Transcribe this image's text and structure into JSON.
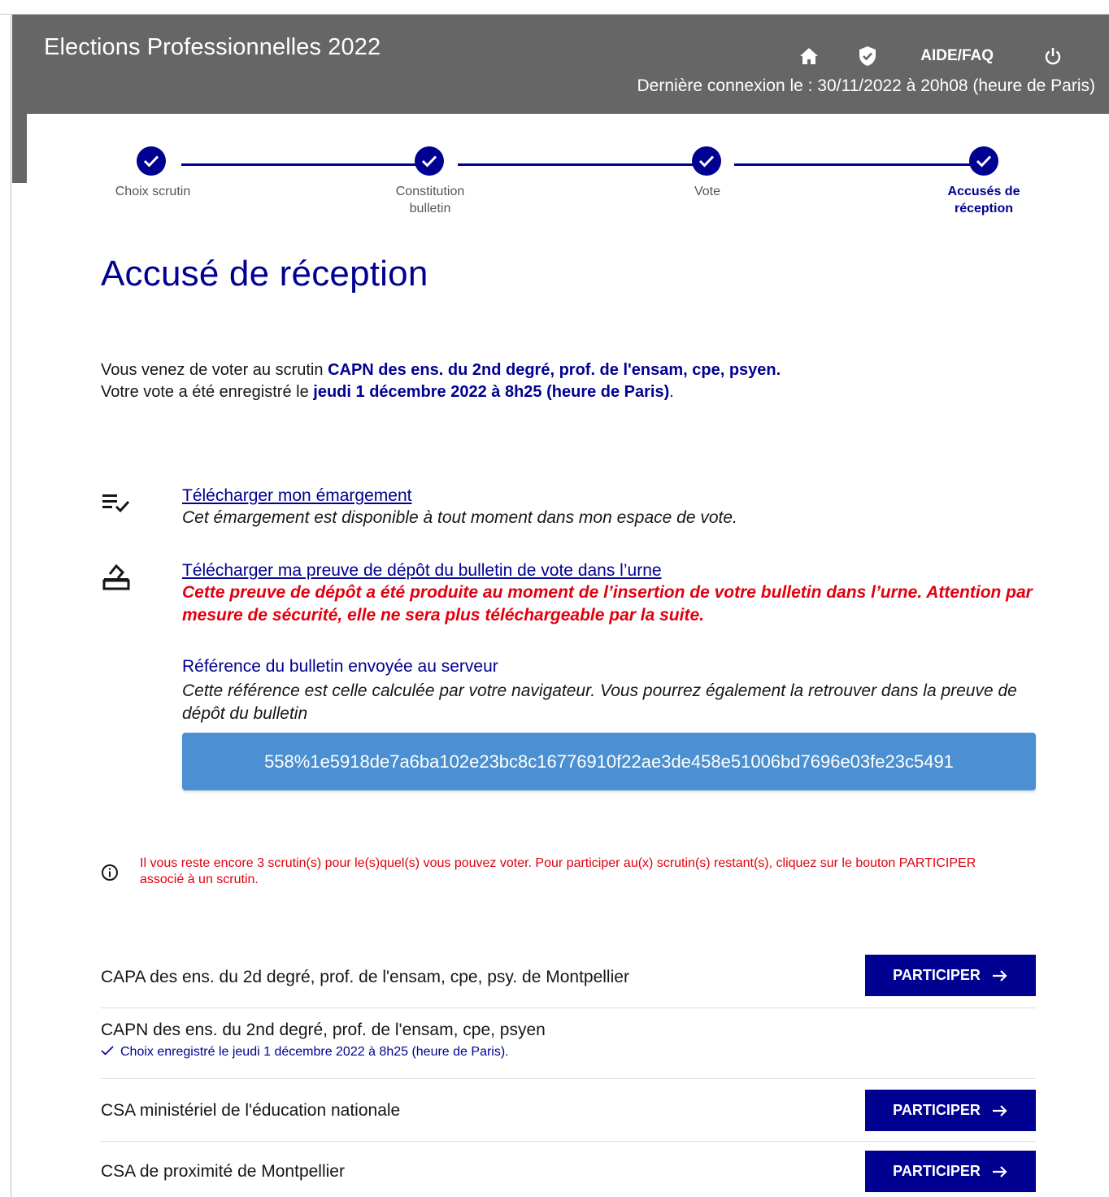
{
  "header": {
    "app_title": "Elections Professionnelles 2022",
    "aide_label": "AIDE/FAQ",
    "last_login": "Dernière connexion le : 30/11/2022 à 20h08 (heure de Paris)",
    "icons": [
      "home-icon",
      "shield-check-icon",
      "power-icon"
    ]
  },
  "stepper": {
    "steps": [
      {
        "label": "Choix scrutin",
        "done": true
      },
      {
        "label": "Constitution\nbulletin",
        "done": true
      },
      {
        "label": "Vote",
        "done": true
      },
      {
        "label": "Accusés de\nréception",
        "done": true,
        "active": true
      }
    ]
  },
  "main": {
    "title": "Accusé de réception",
    "intro": {
      "line1_prefix": "Vous venez de voter au scrutin ",
      "ballot_name": "CAPN des ens. du 2nd degré, prof. de l'ensam, cpe, psyen.",
      "line2_prefix": "Votre vote a été enregistré le ",
      "vote_date": "jeudi 1 décembre 2022 à 8h25 (heure de Paris)",
      "line2_suffix": "."
    },
    "emargement": {
      "link": "Télécharger mon émargement",
      "desc": "Cet émargement est disponible à tout moment dans mon espace de vote."
    },
    "preuve": {
      "link": "Télécharger ma preuve de dépôt du bulletin de vote dans l’urne",
      "warning": "Cette preuve de dépôt a été produite au moment de l’insertion de votre bulletin dans l’urne. Attention par mesure de sécurité, elle ne sera plus téléchargeable par la suite."
    },
    "reference": {
      "label": "Référence du bulletin envoyée au serveur",
      "desc": "Cette référence est celle calculée par votre navigateur. Vous pourrez également la retrouver dans la preuve de dépôt du bulletin",
      "value": "558%1e5918de7a6ba102e23bc8c16776910f22ae3de458e51006bd7696e03fe23c5491"
    },
    "info": "Il vous reste encore 3 scrutin(s) pour le(s)quel(s) vous pouvez voter. Pour participer au(x) scrutin(s) restant(s), cliquez sur le bouton PARTICIPER associé à un scrutin.",
    "participate_label": "PARTICIPER",
    "ballots": [
      {
        "name": "CAPA des ens. du 2d degré, prof. de l'ensam, cpe, psy. de Montpellier",
        "status": "",
        "can_participate": true
      },
      {
        "name": "CAPN des ens. du 2nd degré, prof. de l'ensam, cpe, psyen",
        "status": "Choix enregistré le jeudi 1 décembre 2022 à 8h25 (heure de Paris).",
        "can_participate": false
      },
      {
        "name": "CSA ministériel de l'éducation nationale",
        "status": "",
        "can_participate": true
      },
      {
        "name": "CSA de proximité de Montpellier",
        "status": "",
        "can_participate": true
      }
    ]
  },
  "colors": {
    "header_bg": "#666666",
    "primary": "#000091",
    "danger": "#e1000f",
    "reference_bg": "#4a90d2"
  }
}
